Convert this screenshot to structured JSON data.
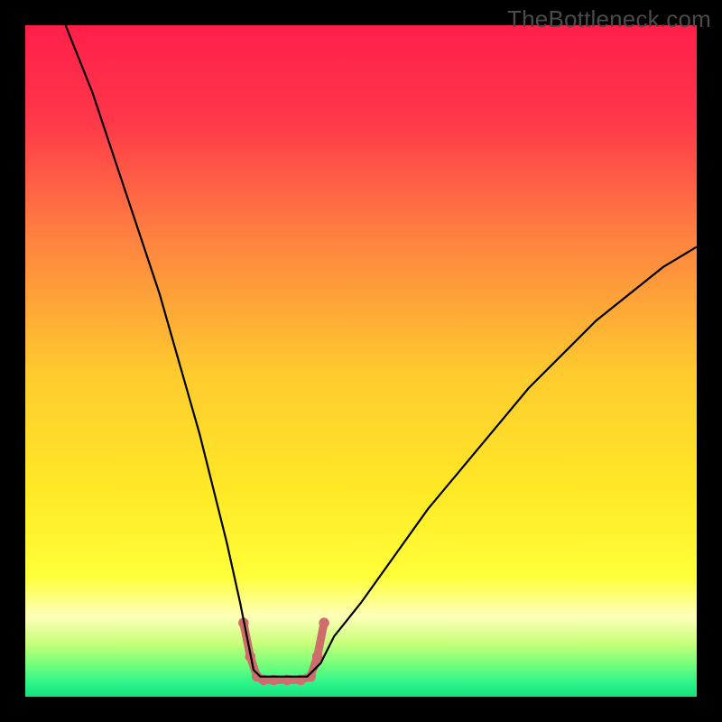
{
  "watermark": {
    "text": "TheBottleneck.com"
  },
  "chart_data": {
    "type": "area",
    "title": "",
    "xlabel": "",
    "ylabel": "",
    "xlim": [
      0,
      100
    ],
    "ylim": [
      0,
      100
    ],
    "background_gradient": {
      "stops": [
        {
          "pct": 0,
          "color": "#ff1f4a"
        },
        {
          "pct": 14,
          "color": "#ff374a"
        },
        {
          "pct": 32,
          "color": "#fe8340"
        },
        {
          "pct": 52,
          "color": "#fecb2e"
        },
        {
          "pct": 70,
          "color": "#ffea26"
        },
        {
          "pct": 82,
          "color": "#ffff39"
        },
        {
          "pct": 88,
          "color": "#feffb8"
        },
        {
          "pct": 92,
          "color": "#c9ff7a"
        },
        {
          "pct": 95,
          "color": "#7aff7a"
        },
        {
          "pct": 98,
          "color": "#2cf58a"
        },
        {
          "pct": 100,
          "color": "#15e07d"
        }
      ]
    },
    "series": [
      {
        "name": "bottleneck-curve",
        "color": "#000000",
        "stroke_width": 2.2,
        "x": [
          6,
          8,
          10,
          12,
          14,
          16,
          18,
          20,
          22,
          24,
          26,
          28,
          30,
          32,
          33,
          34,
          35,
          36,
          38,
          40,
          42,
          44,
          46,
          50,
          55,
          60,
          65,
          70,
          75,
          80,
          85,
          90,
          95,
          100
        ],
        "y": [
          100,
          95,
          90,
          84,
          78,
          72,
          66,
          60,
          53,
          46,
          39,
          31,
          23,
          14,
          9,
          4,
          3,
          3,
          3,
          3,
          3,
          5,
          9,
          14,
          21,
          28,
          34,
          40,
          46,
          51,
          56,
          60,
          64,
          67
        ]
      },
      {
        "name": "optimal-zone",
        "color": "#cf6d6d",
        "stroke_width": 9,
        "linecap": "round",
        "x": [
          32.5,
          33.5,
          34.5,
          35.5,
          37.0,
          39.0,
          41.0,
          42.5,
          43.5,
          44.5
        ],
        "y": [
          11.0,
          6.0,
          3.0,
          2.5,
          2.5,
          2.5,
          2.5,
          3.0,
          6.0,
          11.0
        ]
      }
    ]
  }
}
